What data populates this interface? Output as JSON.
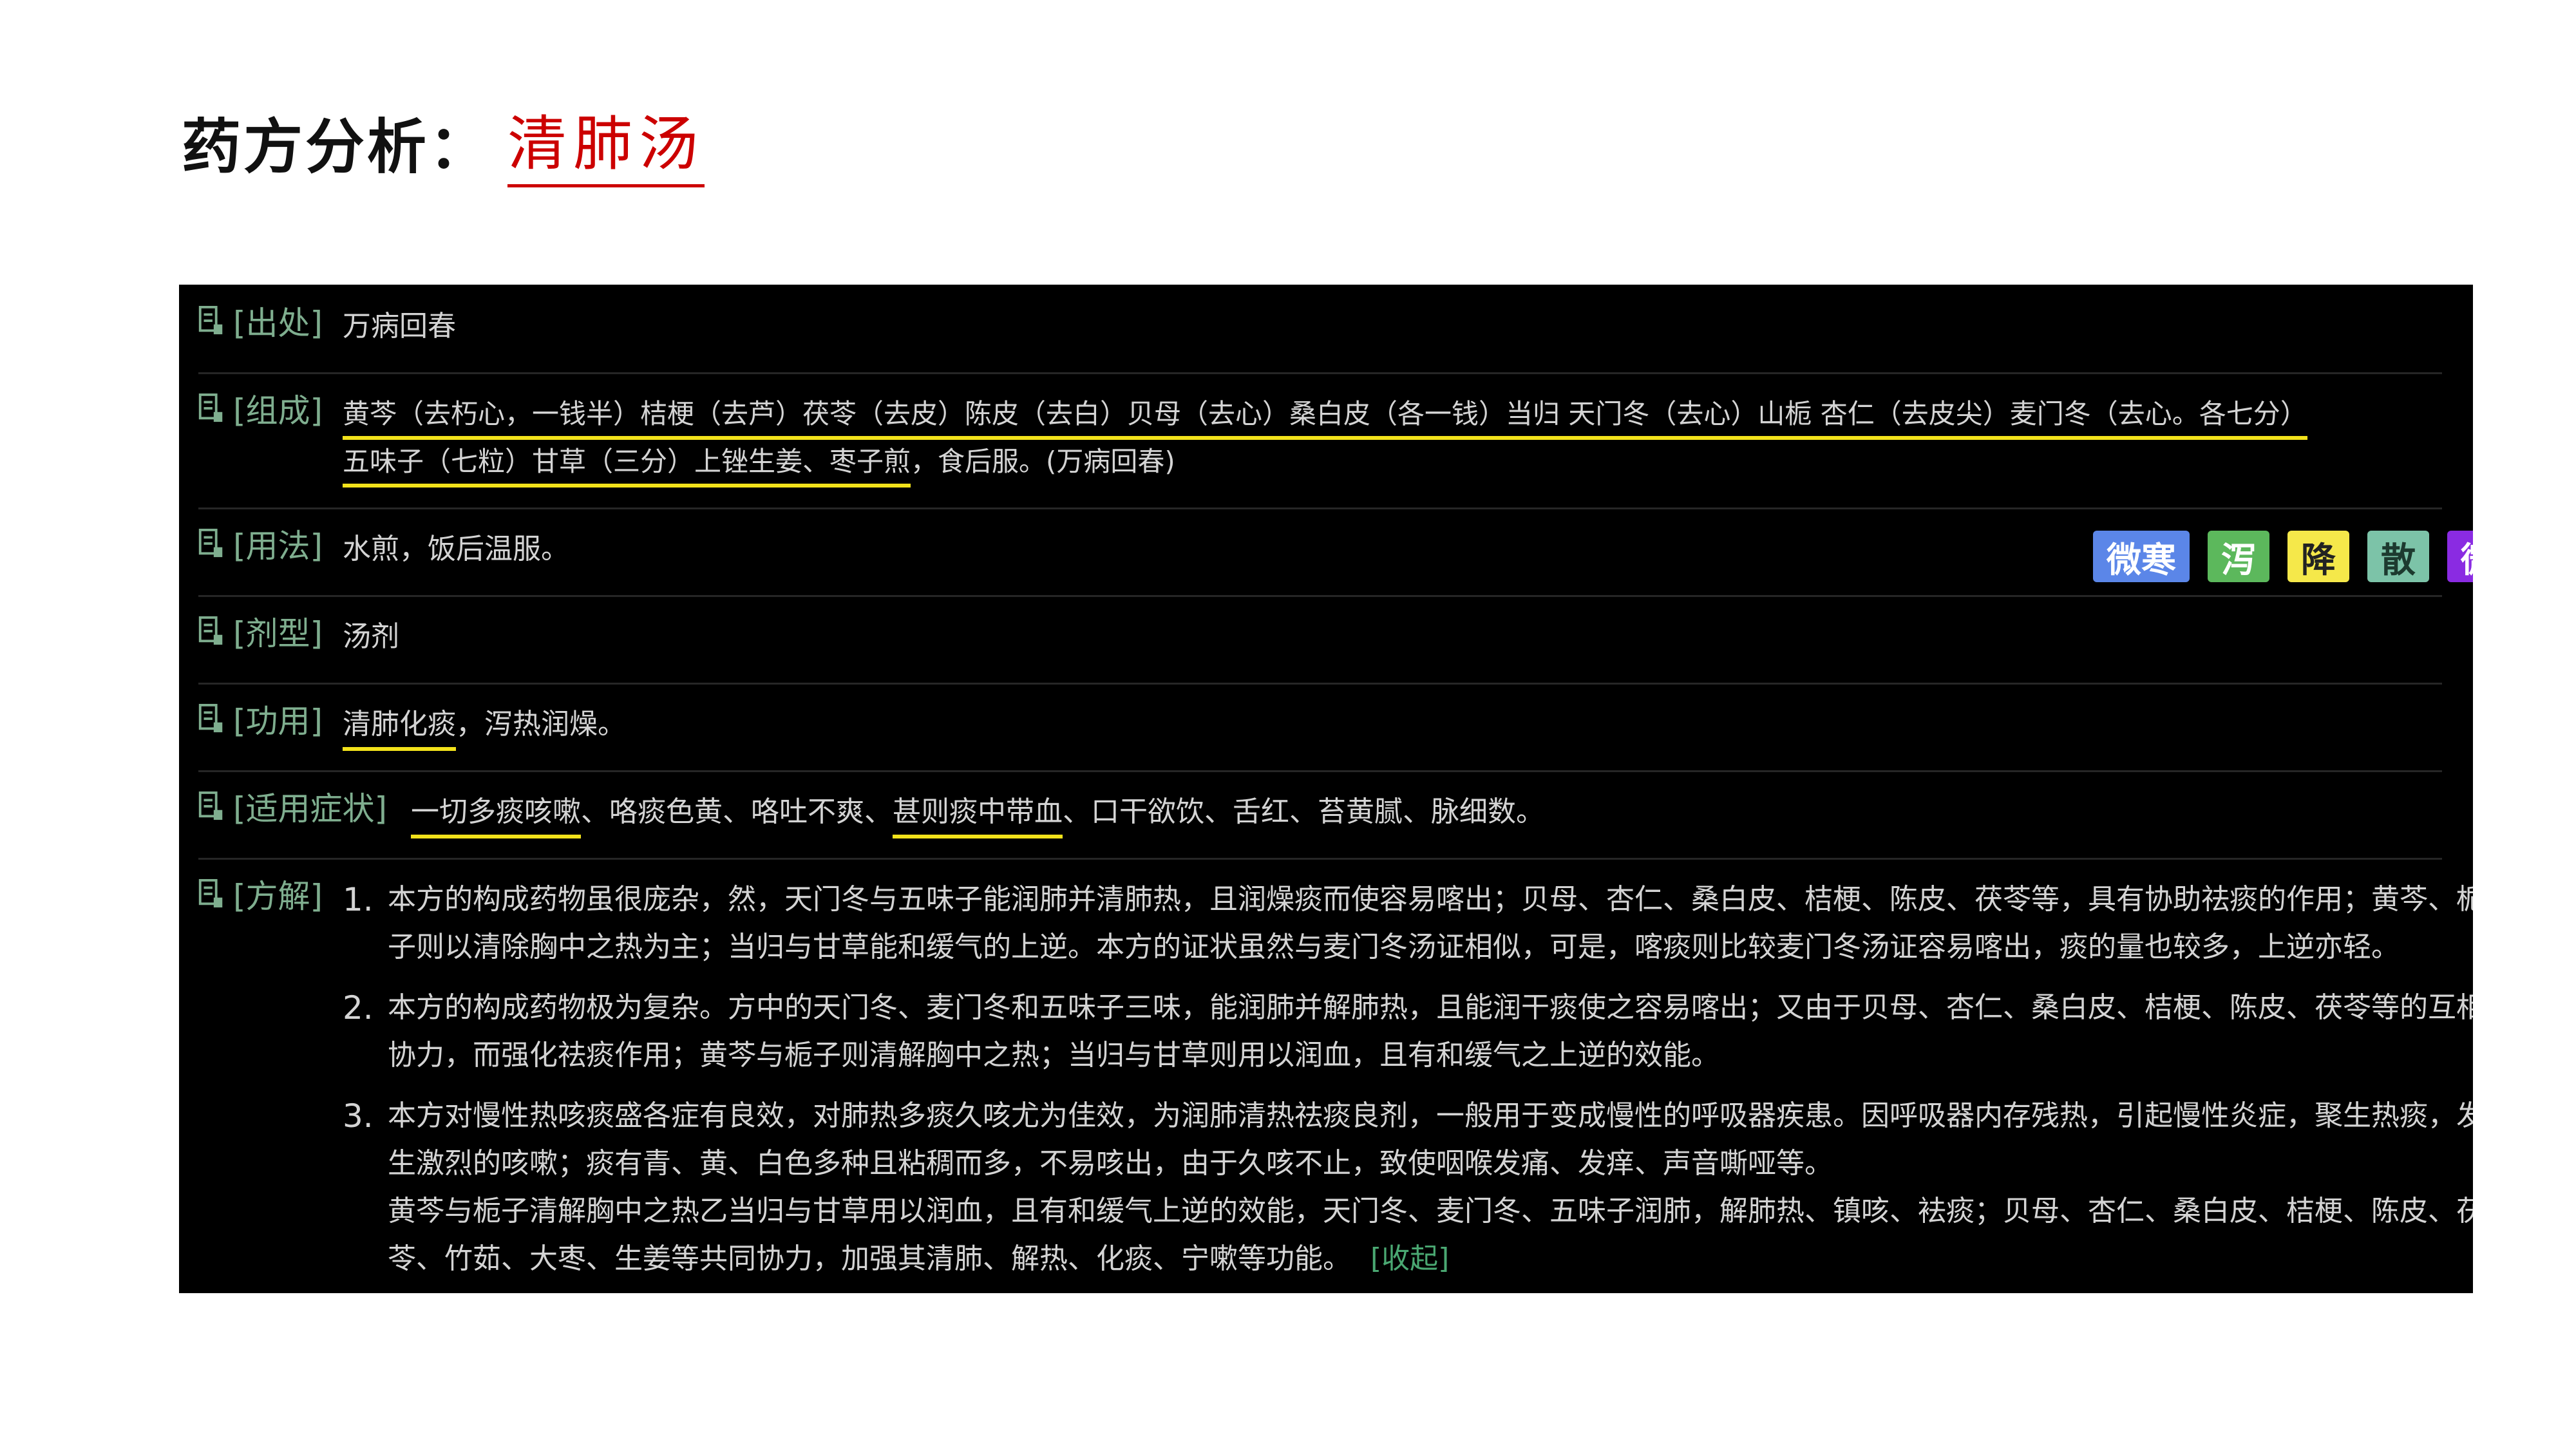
{
  "header": {
    "title_main": "药方分析",
    "title_sep": "：",
    "title_highlight": "清肺汤"
  },
  "labels": {
    "source": "[出处]",
    "composition": "[组成]",
    "usage": "[用法]",
    "dosage_form": "[剂型]",
    "function": "[功用]",
    "indications": "[适用症状]",
    "explanation": "[方解]"
  },
  "source": "万病回春",
  "composition": {
    "line1": "黄芩（去朽心，一钱半）桔梗（去芦）茯苓（去皮）陈皮（去白）贝母（去心）桑白皮（各一钱）当归 天门冬（去心）山栀 杏仁（去皮尖）麦门冬（去心。各七分）",
    "line2_underlined": "五味子（七粒）甘草（三分）上锉生姜、枣子煎",
    "line2_rest": "，食后服。(万病回春)"
  },
  "usage": "水煎，饭后温服。",
  "dosage_form": "汤剂",
  "function": {
    "underlined": "清肺化痰",
    "rest": "，泻热润燥。"
  },
  "indications": {
    "part1": "一切多痰咳嗽",
    "part2": "、咯痰色黄、咯吐不爽、",
    "part3": "甚则痰中带血",
    "part4": "、口干欲饮、舌红、苔黄腻、脉细数。"
  },
  "tags": [
    "微寒",
    "泻",
    "降",
    "散",
    "微燥"
  ],
  "explanation": [
    {
      "num": "1.",
      "lines": [
        "本方的构成药物虽很庞杂，然，天门冬与五味子能润肺并清肺热，且润燥痰而使容易喀出；贝母、杏仁、桑白皮、桔梗、陈皮、茯苓等，具有协助祛痰的作用；黄芩、栀",
        "子则以清除胸中之热为主；当归与甘草能和缓气的上逆。本方的证状虽然与麦门冬汤证相似，可是，喀痰则比较麦门冬汤证容易喀出，痰的量也较多，上逆亦轻。"
      ]
    },
    {
      "num": "2.",
      "lines": [
        "本方的构成药物极为复杂。方中的天门冬、麦门冬和五味子三味，能润肺并解肺热，且能润干痰使之容易喀出；又由于贝母、杏仁、桑白皮、桔梗、陈皮、茯苓等的互相",
        "协力，而强化祛痰作用；黄芩与栀子则清解胸中之热；当归与甘草则用以润血，且有和缓气之上逆的效能。"
      ]
    },
    {
      "num": "3.",
      "lines": [
        "本方对慢性热咳痰盛各症有良效，对肺热多痰久咳尤为佳效，为润肺清热祛痰良剂，一般用于变成慢性的呼吸器疾患。因呼吸器内存残热，引起慢性炎症，聚生热痰，发",
        "生激烈的咳嗽；痰有青、黄、白色多种且粘稠而多，不易咳出，由于久咳不止，致使咽喉发痛、发痒、声音嘶哑等。",
        "黄芩与栀子清解胸中之热乙当归与甘草用以润血，且有和缓气上逆的效能，天门冬、麦门冬、五味子润肺，解肺热、镇咳、袪痰；贝母、杏仁、桑白皮、桔梗、陈皮、茯",
        "苓、竹茹、大枣、生姜等共同协力，加强其清肺、解热、化痰、宁嗽等功能。"
      ]
    }
  ],
  "collapse_label": "[收起]"
}
